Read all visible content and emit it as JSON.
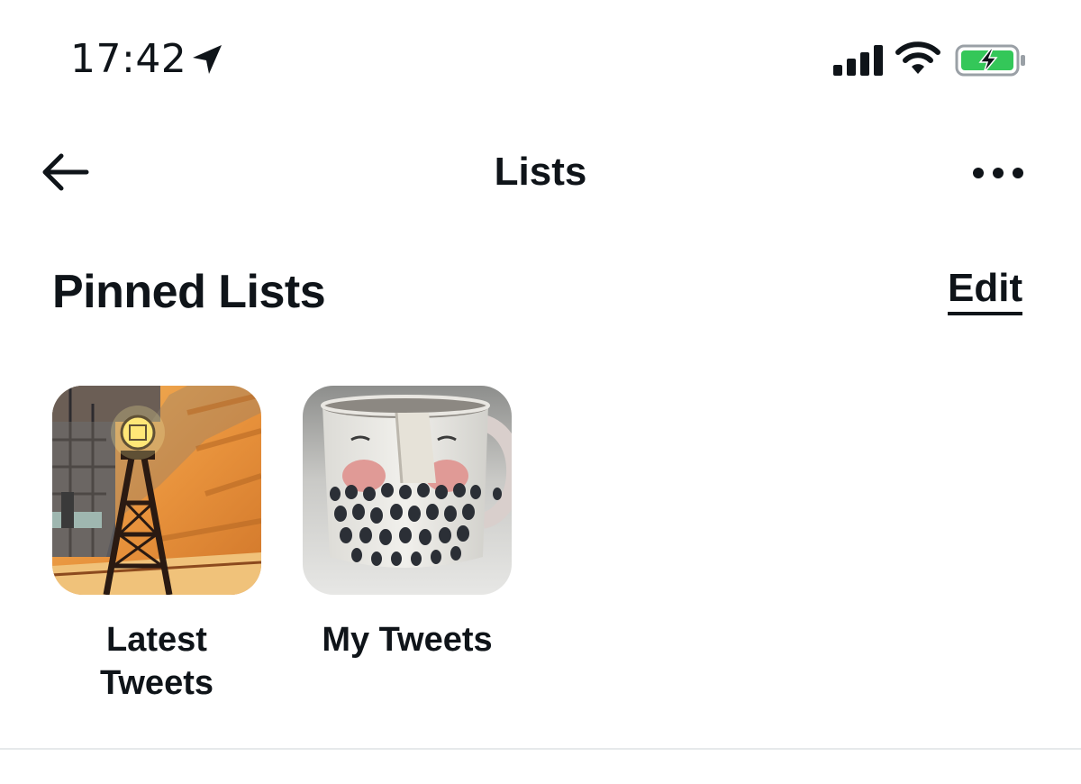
{
  "status_bar": {
    "time": "17:42",
    "location_icon": "location-arrow-icon",
    "signal_icon": "cellular-signal-icon",
    "wifi_icon": "wifi-icon",
    "battery_icon": "battery-charging-icon",
    "battery_color": "#34c759"
  },
  "header": {
    "back_icon": "back-arrow-icon",
    "title": "Lists",
    "more_icon": "more-horizontal-icon"
  },
  "pinned": {
    "title": "Pinned Lists",
    "edit_label": "Edit",
    "items": [
      {
        "label": "Latest Tweets",
        "image": "comic-lamp-tower-thumbnail"
      },
      {
        "label": "My Tweets",
        "image": "polka-dot-mug-thumbnail"
      }
    ]
  }
}
